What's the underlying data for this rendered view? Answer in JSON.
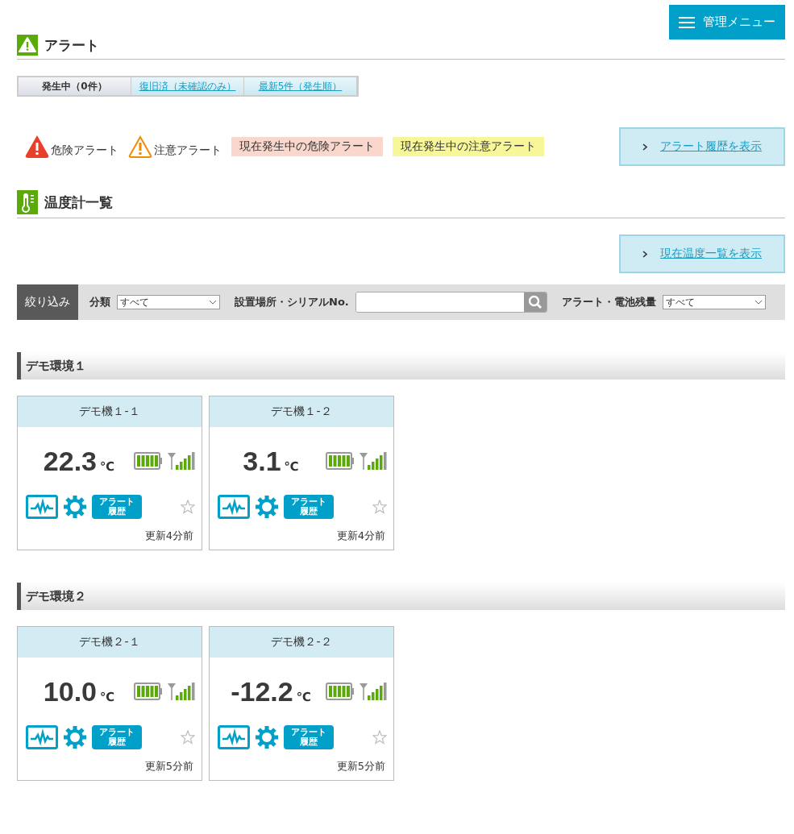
{
  "menu_button": {
    "label": "管理メニュー"
  },
  "alert_section": {
    "title": "アラート",
    "tabs": [
      {
        "label": "発生中（0件）",
        "selected": true
      },
      {
        "label": "復旧済（未確認のみ）",
        "selected": false
      },
      {
        "label": "最新5件（発生順）",
        "selected": false
      }
    ],
    "legend": [
      {
        "kind": "danger-icon",
        "label": "危険アラート"
      },
      {
        "kind": "warning-icon",
        "label": "注意アラート"
      },
      {
        "kind": "swatch",
        "label": "現在発生中の危険アラート",
        "color": "#fad7cd"
      },
      {
        "kind": "swatch",
        "label": "現在発生中の注意アラート",
        "color": "#f7f79a"
      }
    ],
    "history_link": "アラート履歴を表示"
  },
  "thermo_section": {
    "title": "温度計一覧",
    "list_link": "現在温度一覧を表示",
    "filter": {
      "label": "絞り込み",
      "category_label": "分類",
      "category_value": "すべて",
      "location_label": "設置場所・シリアルNo.",
      "status_label": "アラート・電池残量",
      "status_value": "すべて"
    },
    "groups": [
      {
        "name": "デモ環境１",
        "devices": [
          {
            "name": "デモ機１-１",
            "temperature": "22.3",
            "unit": "℃",
            "alert_label": "アラート履歴",
            "favorite": false,
            "updated": "更新4分前"
          },
          {
            "name": "デモ機１-２",
            "temperature": "3.1",
            "unit": "℃",
            "alert_label": "アラート履歴",
            "favorite": false,
            "updated": "更新4分前"
          }
        ]
      },
      {
        "name": "デモ環境２",
        "devices": [
          {
            "name": "デモ機２-１",
            "temperature": "10.0",
            "unit": "℃",
            "alert_label": "アラート履歴",
            "favorite": false,
            "updated": "更新5分前"
          },
          {
            "name": "デモ機２-２",
            "temperature": "-12.2",
            "unit": "℃",
            "alert_label": "アラート履歴",
            "favorite": false,
            "updated": "更新5分前"
          }
        ]
      }
    ]
  }
}
